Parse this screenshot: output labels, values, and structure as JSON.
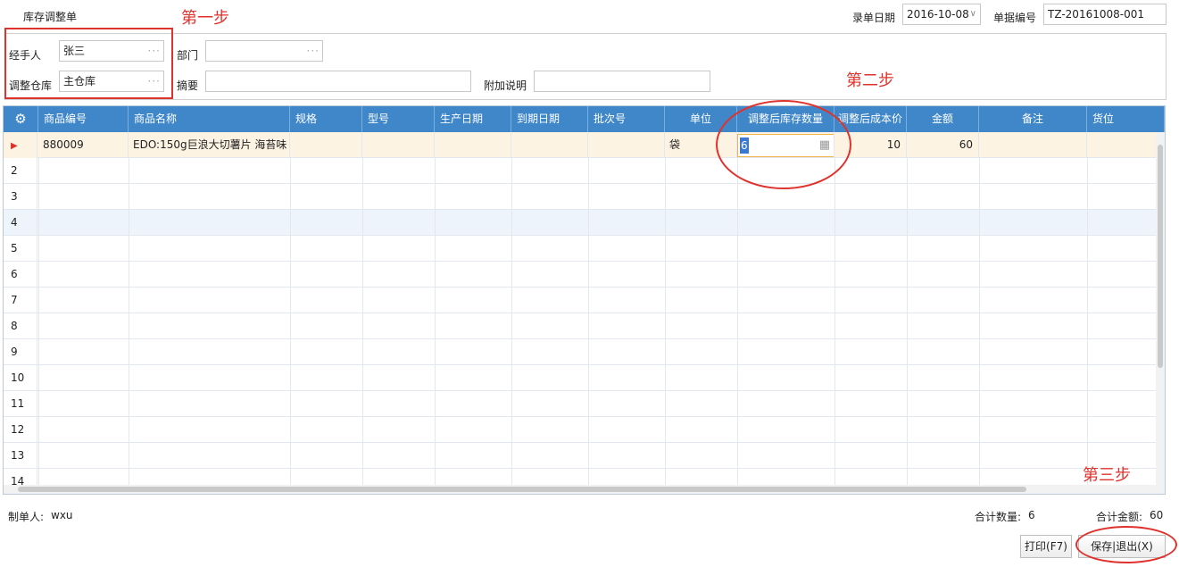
{
  "page_title": "库存调整单",
  "annotations": {
    "step1": "第一步",
    "step2": "第二步",
    "step3": "第三步"
  },
  "header_fields": {
    "entry_date_label": "录单日期",
    "entry_date_value": "2016-10-08",
    "doc_no_label": "单据编号",
    "doc_no_value": "TZ-20161008-001"
  },
  "form": {
    "handler_label": "经手人",
    "handler_value": "张三",
    "warehouse_label": "调整仓库",
    "warehouse_value": "主仓库",
    "department_label": "部门",
    "department_value": "",
    "summary_label": "摘要",
    "summary_value": "",
    "note_label": "附加说明",
    "note_value": ""
  },
  "grid": {
    "columns": [
      "商品编号",
      "商品名称",
      "规格",
      "型号",
      "生产日期",
      "到期日期",
      "批次号",
      "单位",
      "调整后库存数量",
      "调整后成本价",
      "金额",
      "备注",
      "货位"
    ],
    "rows": [
      {
        "num": "",
        "code": "880009",
        "name": "EDO:150g巨浪大切薯片 海苔味",
        "spec": "",
        "model": "",
        "mfg_date": "",
        "exp_date": "",
        "batch": "",
        "unit": "袋",
        "qty": "6",
        "cost": "10",
        "amount": "60",
        "remark": "",
        "location": ""
      },
      {
        "num": "2"
      },
      {
        "num": "3"
      },
      {
        "num": "4"
      },
      {
        "num": "5"
      },
      {
        "num": "6"
      },
      {
        "num": "7"
      },
      {
        "num": "8"
      },
      {
        "num": "9"
      },
      {
        "num": "10"
      },
      {
        "num": "11"
      },
      {
        "num": "12"
      },
      {
        "num": "13"
      },
      {
        "num": "14"
      }
    ]
  },
  "footer": {
    "creator_label": "制单人:",
    "creator_value": "wxu",
    "total_qty_label": "合计数量:",
    "total_qty_value": "6",
    "total_amount_label": "合计金额:",
    "total_amount_value": "60",
    "print_button": "打印(F7)",
    "save_exit_button": "保存|退出(X)"
  },
  "colors": {
    "header_blue": "#3f87c8",
    "annotation_red": "#e0322d",
    "selected_row": "#fdf3e3",
    "alt_row": "#eef4fb"
  }
}
